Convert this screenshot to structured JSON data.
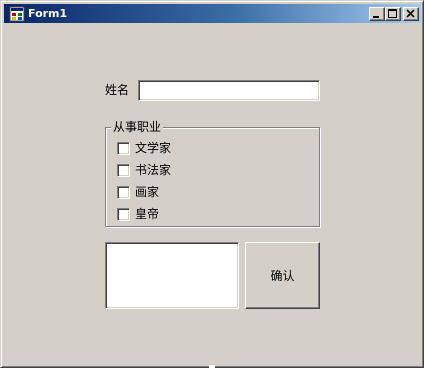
{
  "window": {
    "title": "Form1",
    "icon": "app-window-icon",
    "caption_buttons": [
      "minimize-icon",
      "maximize-icon",
      "close-icon"
    ]
  },
  "form": {
    "name_label": "姓名",
    "name_value": "",
    "occupation_group": {
      "caption": "从事职业",
      "options": [
        {
          "label": "文学家",
          "checked": false
        },
        {
          "label": "书法家",
          "checked": false
        },
        {
          "label": "画家",
          "checked": false
        },
        {
          "label": "皇帝",
          "checked": false
        }
      ]
    },
    "output_text": "",
    "confirm_label": "确认"
  },
  "colors": {
    "window_face": "#d4d0c8",
    "titlebar_start": "#0a246a",
    "titlebar_end": "#a6caf0",
    "title_text": "#ffffff"
  }
}
